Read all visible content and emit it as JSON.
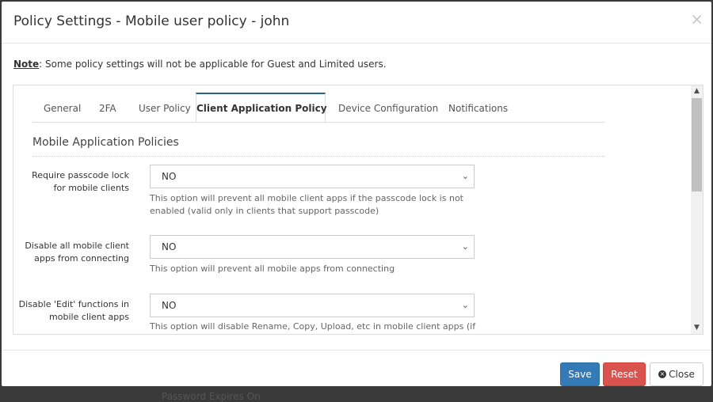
{
  "background": {
    "behind_text": "Password Expires On"
  },
  "modal": {
    "title": "Policy Settings - Mobile user policy - john",
    "close_glyph": "×"
  },
  "note": {
    "label": "Note",
    "text": ": Some policy settings will not be applicable for Guest and Limited users."
  },
  "tabs": [
    {
      "label": "General"
    },
    {
      "label": "2FA"
    },
    {
      "label": "User Policy"
    },
    {
      "label": "Client Application Policy",
      "active": true
    },
    {
      "label": "Device Configuration"
    },
    {
      "label": "Notifications"
    }
  ],
  "section": {
    "title": "Mobile Application Policies"
  },
  "fields": [
    {
      "label": "Require passcode lock for mobile clients",
      "value": "NO",
      "help": "This option will prevent all mobile client apps if the passcode lock is not enabled (valid only in clients that support passcode)"
    },
    {
      "label": "Disable all mobile client apps from connecting",
      "value": "NO",
      "help": "This option will prevent all mobile apps from connecting"
    },
    {
      "label": "Disable 'Edit' functions in mobile client apps",
      "value": "NO",
      "help": "This option will disable Rename, Copy, Upload, etc in mobile client apps (if"
    }
  ],
  "footer": {
    "save_label": "Save",
    "reset_label": "Reset",
    "close_label": "Close"
  },
  "colors": {
    "primary": "#337ab7",
    "danger": "#d9534f",
    "active_tab_border": "#2a6496"
  },
  "icons": {
    "close": "close-icon",
    "caret": "chevron-down-icon",
    "close_button": "times-circle-icon"
  }
}
